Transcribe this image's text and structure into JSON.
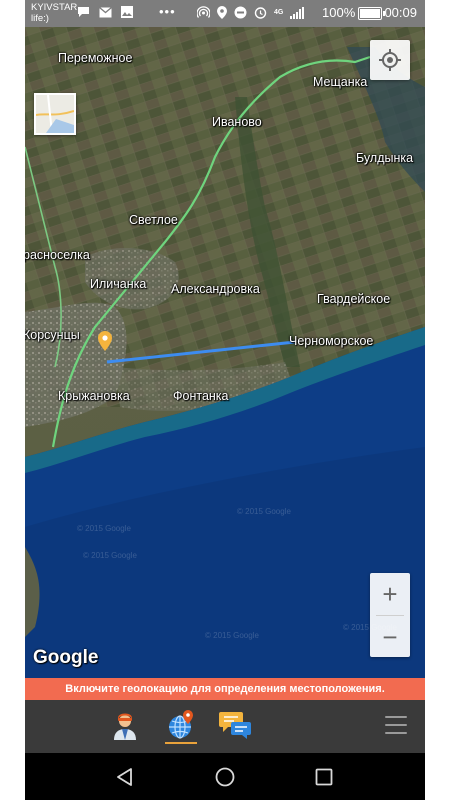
{
  "status_bar": {
    "carrier_line1": "KYIVSTAR",
    "carrier_line2": "life:)",
    "overflow": "•••",
    "network_type": "4G",
    "battery_percent_text": "100%",
    "battery_level": 1.0,
    "time": "00:09"
  },
  "map": {
    "places": [
      {
        "name": "Переможное",
        "id": "peremozhnoe"
      },
      {
        "name": "Мещанка",
        "id": "meshchanka"
      },
      {
        "name": "Иваново",
        "id": "ivanovo"
      },
      {
        "name": "Булдынка",
        "id": "buldynka"
      },
      {
        "name": "Светлое",
        "id": "svetloe"
      },
      {
        "name": "расноселка",
        "id": "krasnoselka"
      },
      {
        "name": "Иличанка",
        "id": "ilichanka"
      },
      {
        "name": "Александровка",
        "id": "aleksandrovka"
      },
      {
        "name": "Гвардейское",
        "id": "gvardeyskoe"
      },
      {
        "name": "Корсунцы",
        "id": "korsuntsy"
      },
      {
        "name": "Черноморское",
        "id": "chernomorskoe"
      },
      {
        "name": "Крыжановка",
        "id": "kryzhanovka"
      },
      {
        "name": "Фонтанка",
        "id": "fontanka"
      }
    ],
    "watermark": "© 2015 Google",
    "google_logo": "Google",
    "zoom_in": "+",
    "zoom_out": "−",
    "colors": {
      "sea": "#0d3d86",
      "route": "#3d8cf0",
      "road": "#6fd47e",
      "marker": "#f4b43d"
    }
  },
  "banner": {
    "text": "Включите геолокацию для определения местоположения.",
    "color": "#f26b50"
  },
  "app_nav": {
    "items": [
      {
        "icon": "person-icon",
        "active": false
      },
      {
        "icon": "globe-marker-icon",
        "active": true
      },
      {
        "icon": "chat-bubbles-icon",
        "active": false
      }
    ],
    "menu_icon": "hamburger-menu-icon",
    "accent": "#e9a23b"
  },
  "system_nav": {
    "back_icon": "back-triangle-icon",
    "home_icon": "home-circle-icon",
    "recents_icon": "recents-square-icon"
  }
}
